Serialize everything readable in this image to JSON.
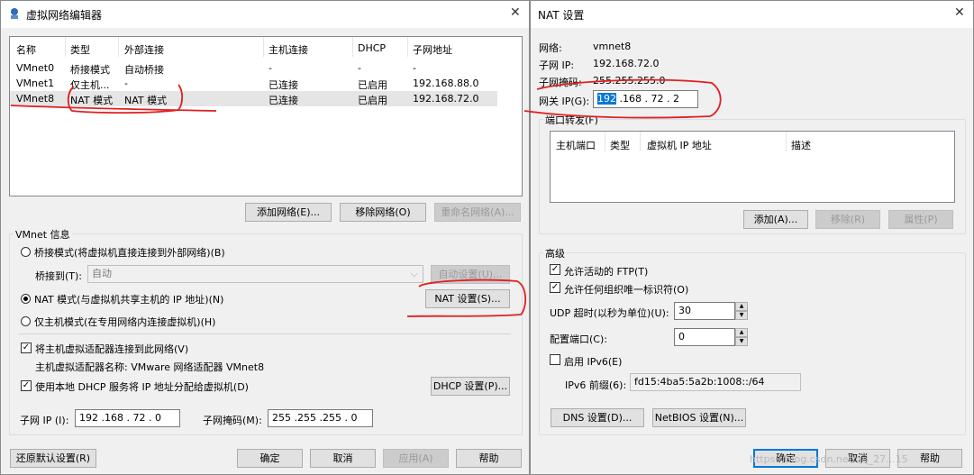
{
  "left_dialog": {
    "title": "虚拟网络编辑器",
    "table": {
      "headers": [
        "名称",
        "类型",
        "外部连接",
        "主机连接",
        "DHCP",
        "子网地址"
      ],
      "rows": [
        [
          "VMnet0",
          "桥接模式",
          "自动桥接",
          "-",
          "-",
          "-"
        ],
        [
          "VMnet1",
          "仅主机...",
          "-",
          "已连接",
          "已启用",
          "192.168.88.0"
        ],
        [
          "VMnet8",
          "NAT 模式",
          "NAT 模式",
          "已连接",
          "已启用",
          "192.168.72.0"
        ]
      ]
    },
    "buttons": {
      "add_network": "添加网络(E)...",
      "remove_network": "移除网络(O)",
      "rename_network": "重命名网络(A)..."
    },
    "vmnet_info": {
      "label": "VMnet 信息",
      "bridge_mode": "桥接模式(将虚拟机直接连接到外部网络)(B)",
      "bridged_to_label": "桥接到(T):",
      "bridged_to_value": "自动",
      "auto_settings": "自动设置(U)...",
      "nat_mode": "NAT 模式(与虚拟机共享主机的 IP 地址)(N)",
      "nat_settings": "NAT 设置(S)...",
      "host_only_mode": "仅主机模式(在专用网络内连接虚拟机)(H)",
      "connect_adapter": "将主机虚拟适配器连接到此网络(V)",
      "adapter_name": "主机虚拟适配器名称: VMware 网络适配器 VMnet8",
      "use_dhcp": "使用本地 DHCP 服务将 IP 地址分配给虚拟机(D)",
      "dhcp_settings": "DHCP 设置(P)...",
      "subnet_ip_label": "子网 IP (I):",
      "subnet_ip": "192 .168 . 72 . 0",
      "subnet_mask_label": "子网掩码(M):",
      "subnet_mask": "255 .255 .255 . 0"
    },
    "footer": {
      "restore_defaults": "还原默认设置(R)",
      "ok": "确定",
      "cancel": "取消",
      "apply": "应用(A)",
      "help": "帮助"
    }
  },
  "nat_dialog": {
    "title": "NAT 设置",
    "network_label": "网络:",
    "network_value": "vmnet8",
    "subnet_ip_label": "子网 IP:",
    "subnet_ip_value": "192.168.72.0",
    "subnet_mask_label": "子网掩码:",
    "subnet_mask_value": "255.255.255.0",
    "gateway_label": "网关 IP(G):",
    "gateway_selected": "192",
    "gateway_rest": " .168 . 72 . 2",
    "port_forwarding": {
      "label": "端口转发(F)",
      "headers": [
        "主机端口",
        "类型",
        "虚拟机 IP 地址",
        "描述"
      ],
      "add": "添加(A)...",
      "remove": "移除(R)",
      "properties": "属性(P)"
    },
    "advanced": {
      "label": "高级",
      "allow_ftp": "允许活动的 FTP(T)",
      "allow_uuid": "允许任何组织唯一标识符(O)",
      "udp_timeout_label": "UDP 超时(以秒为单位)(U):",
      "udp_timeout": "30",
      "config_port_label": "配置端口(C):",
      "config_port": "0",
      "enable_ipv6": "启用 IPv6(E)",
      "ipv6_prefix_label": "IPv6 前缀(6):",
      "ipv6_prefix": "fd15:4ba5:5a2b:1008::/64",
      "dns_settings": "DNS 设置(D)...",
      "netbios_settings": "NetBIOS 设置(N)..."
    },
    "footer": {
      "ok": "确定",
      "cancel": "取消",
      "help": "帮助"
    }
  },
  "watermark": "https://blog.csdn.net/qq_27...15"
}
